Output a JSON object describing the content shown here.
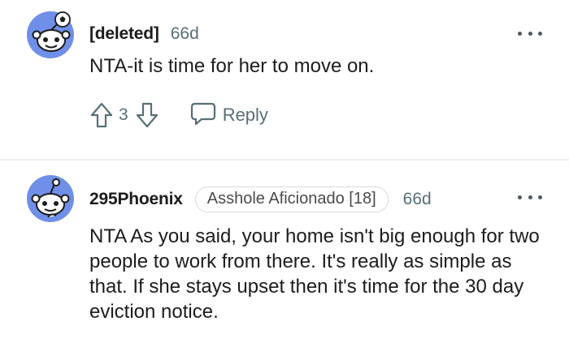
{
  "comments": [
    {
      "username": "[deleted]",
      "time": "66d",
      "text": "NTA-it is time for her to move on.",
      "score": "3",
      "reply_label": "Reply"
    },
    {
      "username": "295Phoenix",
      "flair": "Asshole Aficionado [18]",
      "time": "66d",
      "text": "NTA As you said, your home isn't big enough for two people to work from there. It's really as simple as that. If she stays upset then it's time for the 30 day eviction notice."
    }
  ],
  "colors": {
    "avatar_bg": "#6f8fe8",
    "meta_text": "#576f76",
    "divider": "#edeff1"
  }
}
